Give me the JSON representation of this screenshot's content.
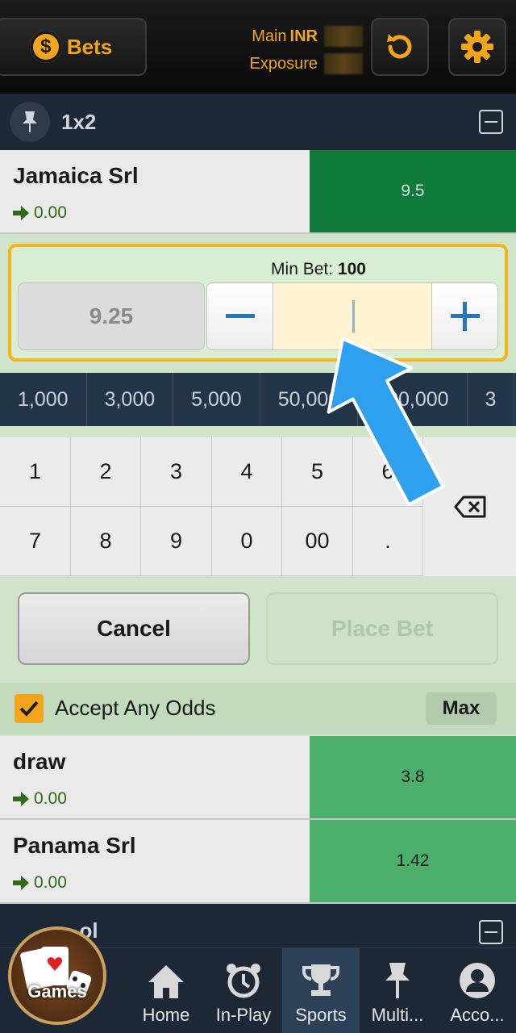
{
  "header": {
    "bets_label": "Bets",
    "main_label": "Main",
    "currency": "INR",
    "exposure_label": "Exposure"
  },
  "market": {
    "title": "1x2",
    "runners": [
      {
        "name": "Jamaica Srl",
        "pl": "0.00",
        "odds": "9.5",
        "odds_color": "#0f7a3a"
      },
      {
        "name": "draw",
        "pl": "0.00",
        "odds": "3.8",
        "odds_color": "#4caf6e"
      },
      {
        "name": "Panama Srl",
        "pl": "0.00",
        "odds": "1.42",
        "odds_color": "#4caf6e"
      }
    ]
  },
  "betslip": {
    "min_bet_label": "Min Bet:",
    "min_bet_value": "100",
    "odds_value": "9.25",
    "stake_value": "",
    "quick_stakes": [
      "1,000",
      "3,000",
      "5,000",
      "50,000",
      "200,000",
      "3"
    ],
    "keypad": [
      "1",
      "2",
      "3",
      "4",
      "5",
      "6",
      "7",
      "8",
      "9",
      "0",
      "00",
      "."
    ],
    "cancel_label": "Cancel",
    "place_label": "Place Bet",
    "accept_label": "Accept Any Odds",
    "accept_checked": true,
    "max_label": "Max"
  },
  "next_market": {
    "title": "..ol"
  },
  "nav": {
    "games": "Games",
    "items": [
      {
        "label": "Home",
        "icon": "home-icon"
      },
      {
        "label": "In-Play",
        "icon": "clock-icon"
      },
      {
        "label": "Sports",
        "icon": "trophy-icon",
        "active": true
      },
      {
        "label": "Multi...",
        "icon": "pin-icon"
      },
      {
        "label": "Acco...",
        "icon": "user-icon"
      }
    ]
  },
  "colors": {
    "accent": "#f2a51a",
    "back_dark": "#0f7a3a",
    "back_light": "#4caf6e",
    "pointer": "#2fa0ee"
  }
}
